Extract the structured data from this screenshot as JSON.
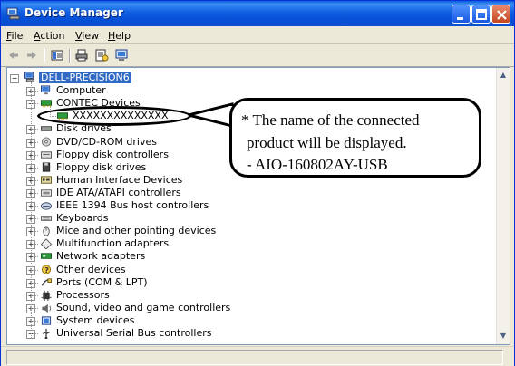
{
  "window": {
    "title": "Device Manager"
  },
  "menu": [
    {
      "label": "File",
      "key": "F",
      "rest": "ile"
    },
    {
      "label": "Action",
      "key": "A",
      "rest": "ction"
    },
    {
      "label": "View",
      "key": "V",
      "rest": "iew"
    },
    {
      "label": "Help",
      "key": "H",
      "rest": "elp"
    }
  ],
  "toolbar": {
    "buttons": [
      "back-icon",
      "forward-icon",
      "properties-view-icon",
      "print-icon",
      "help-properties-icon",
      "scan-hardware-icon"
    ]
  },
  "tree": {
    "root": "DELL-PRECISION6",
    "items": [
      {
        "label": "Computer",
        "icon": "computer-icon",
        "expander": "+"
      },
      {
        "label": "CONTEC Devices",
        "icon": "contec-board-icon",
        "expander": "−"
      },
      {
        "label": "XXXXXXXXXXXXXX",
        "icon": "contec-board-icon",
        "child": true
      },
      {
        "label": "Disk drives",
        "icon": "disk-drive-icon",
        "expander": "+"
      },
      {
        "label": "DVD/CD-ROM drives",
        "icon": "cdrom-icon",
        "expander": "+"
      },
      {
        "label": "Floppy disk controllers",
        "icon": "controller-icon",
        "expander": "+"
      },
      {
        "label": "Floppy disk drives",
        "icon": "floppy-icon",
        "expander": "+"
      },
      {
        "label": "Human Interface Devices",
        "icon": "hid-icon",
        "expander": "+"
      },
      {
        "label": "IDE ATA/ATAPI controllers",
        "icon": "ide-icon",
        "expander": "+"
      },
      {
        "label": "IEEE 1394 Bus host controllers",
        "icon": "firewire-icon",
        "expander": "+"
      },
      {
        "label": "Keyboards",
        "icon": "keyboard-icon",
        "expander": "+"
      },
      {
        "label": "Mice and other pointing devices",
        "icon": "mouse-icon",
        "expander": "+"
      },
      {
        "label": "Multifunction adapters",
        "icon": "multifunction-icon",
        "expander": "+"
      },
      {
        "label": "Network adapters",
        "icon": "network-icon",
        "expander": "+"
      },
      {
        "label": "Other devices",
        "icon": "unknown-device-icon",
        "expander": "+"
      },
      {
        "label": "Ports (COM & LPT)",
        "icon": "port-icon",
        "expander": "+"
      },
      {
        "label": "Processors",
        "icon": "processor-icon",
        "expander": "+"
      },
      {
        "label": "Sound, video and game controllers",
        "icon": "sound-icon",
        "expander": "+"
      },
      {
        "label": "System devices",
        "icon": "system-icon",
        "expander": "+"
      },
      {
        "label": "Universal Serial Bus controllers",
        "icon": "usb-icon",
        "expander": "−"
      }
    ]
  },
  "callout": {
    "line1": "* The name of the connected",
    "line2": "product will be displayed.",
    "line3": "- AIO-160802AY-USB"
  },
  "colors": {
    "titlebar": "#0a5bdc",
    "selection": "#316ac5",
    "window_bg": "#ece9d8"
  }
}
